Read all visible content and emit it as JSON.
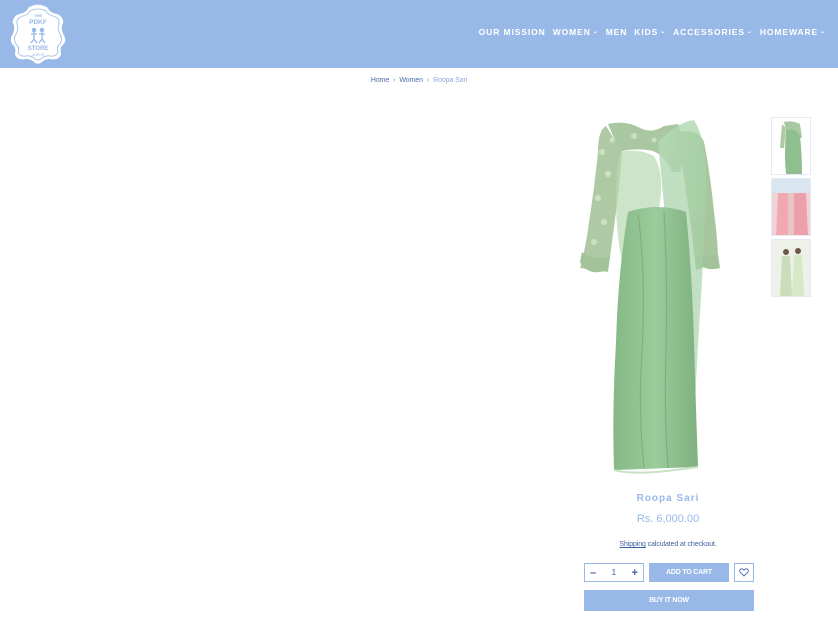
{
  "header": {
    "logo_lines": [
      "THE",
      "PDKF",
      "STORE",
      "JAIPUR"
    ],
    "nav": [
      {
        "label": "OUR MISSION",
        "has_dropdown": false
      },
      {
        "label": "WOMEN",
        "has_dropdown": true
      },
      {
        "label": "MEN",
        "has_dropdown": false
      },
      {
        "label": "KIDS",
        "has_dropdown": true
      },
      {
        "label": "ACCESSORIES",
        "has_dropdown": true
      },
      {
        "label": "HOMEWARE",
        "has_dropdown": true
      }
    ]
  },
  "breadcrumb": {
    "home": "Home",
    "sep": "›",
    "category": "Women",
    "current": "Roopa Sari"
  },
  "product": {
    "title": "Roopa Sari",
    "price": "Rs. 6,000.00",
    "shipping_link": "Shipping",
    "shipping_rest": " calculated at checkout.",
    "quantity": "1",
    "minus": "–",
    "plus": "+",
    "add_to_cart": "ADD TO CART",
    "buy_now": "BUY IT NOW"
  },
  "colors": {
    "accent": "#98b8e8",
    "link": "#3d5f9c",
    "sari_green": "#8fbf8f"
  }
}
